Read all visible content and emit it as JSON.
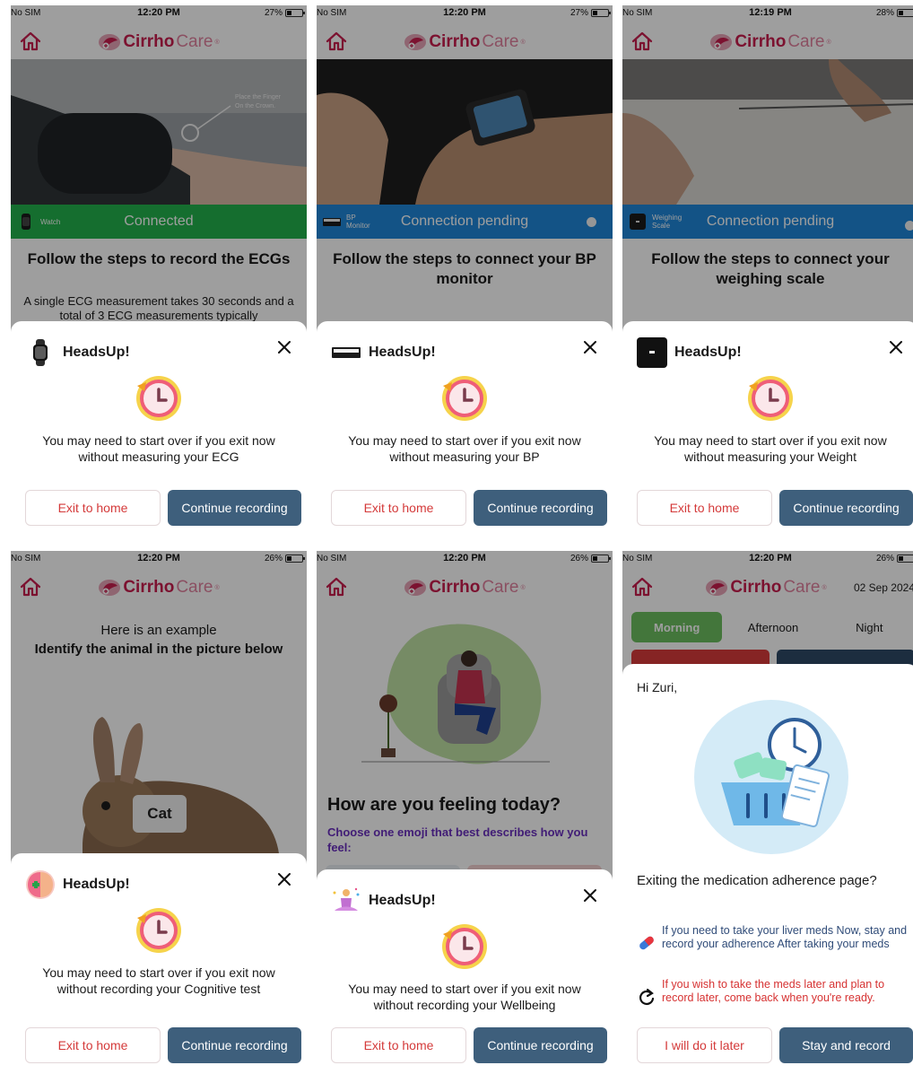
{
  "common": {
    "carrier": "No SIM",
    "logo_bold": "Cirrho",
    "logo_light": "Care",
    "logo_reg": "®",
    "heads_up": "HeadsUp!",
    "exit_label": "Exit to home",
    "continue_label": "Continue recording"
  },
  "colors": {
    "brand": "#c81d4e",
    "primary_button": "#3e5f7c",
    "connected": "#22b24c",
    "pending": "#1f87d8"
  },
  "screens": {
    "ecg": {
      "time": "12:20 PM",
      "battery": "27%",
      "photo_caption": "Place the Finger On the Crown.",
      "device_label": "Watch",
      "status_text": "Connected",
      "title": "Follow the steps to record the ECGs",
      "subtitle": "A single ECG measurement takes 30 seconds and a total of 3 ECG measurements typically",
      "message": "You may need to start over if you exit now without measuring your ECG",
      "sheet_icon": "watch-icon"
    },
    "bp": {
      "time": "12:20 PM",
      "battery": "27%",
      "device_label_1": "BP",
      "device_label_2": "Monitor",
      "status_text": "Connection pending",
      "title": "Follow the steps to connect your BP monitor",
      "message": "You may need to start over if you exit now without measuring your BP",
      "sheet_icon": "bp-monitor-icon"
    },
    "weight": {
      "time": "12:19 PM",
      "battery": "28%",
      "device_label_1": "Weighing",
      "device_label_2": "Scale",
      "status_text": "Connection pending",
      "title": "Follow the steps to connect your weighing scale",
      "message": "You may need to start over if you exit now without measuring your Weight",
      "sheet_icon": "weighing-scale-icon"
    },
    "cognitive": {
      "time": "12:20 PM",
      "battery": "26%",
      "example_text": "Here is an example",
      "instruction": "Identify the animal in the picture below",
      "answer_label": "Cat",
      "message": "You may need to start over if you exit now without recording your Cognitive test",
      "sheet_icon": "brain-icon"
    },
    "wellbeing": {
      "time": "12:20 PM",
      "battery": "26%",
      "question": "How are you feeling today?",
      "prompt": "Choose one emoji that best describes how you feel:",
      "message": "You may need to start over if you exit now without recording your Wellbeing",
      "sheet_icon": "meditation-icon"
    },
    "medication": {
      "time": "12:20 PM",
      "battery": "26%",
      "date": "02 Sep 2024",
      "tabs": [
        "Morning",
        "Afternoon",
        "Night"
      ],
      "greeting": "Hi Zuri,",
      "question": "Exiting the medication adherence page?",
      "info_blue": "If you need to take your liver meds Now, stay and record your adherence After taking your meds",
      "info_red": "If you wish to take the meds later and plan to record later, come back when you're ready.",
      "later_label": "I will do it later",
      "stay_label": "Stay and record"
    }
  }
}
